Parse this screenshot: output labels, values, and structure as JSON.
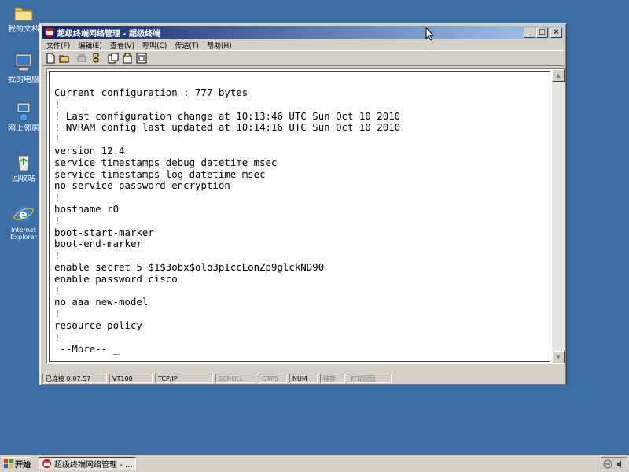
{
  "desktop": {
    "icons": [
      {
        "label": "我的文档"
      },
      {
        "label": "我的电脑"
      },
      {
        "label": "网上邻居"
      },
      {
        "label": "回收站"
      },
      {
        "label": "Internet Explorer"
      }
    ]
  },
  "window": {
    "title": "超级终端网络管理 - 超级终端",
    "menu": [
      {
        "label": "文件(F)"
      },
      {
        "label": "编辑(E)"
      },
      {
        "label": "查看(V)"
      },
      {
        "label": "呼叫(C)"
      },
      {
        "label": "传送(T)"
      },
      {
        "label": "帮助(H)"
      }
    ],
    "toolbar_icons": [
      "new-icon",
      "open-icon",
      "disconnect-icon",
      "connect-icon",
      "send-icon",
      "receive-icon",
      "properties-icon"
    ]
  },
  "terminal": {
    "text": "Current configuration : 777 bytes\n!\n! Last configuration change at 10:13:46 UTC Sun Oct 10 2010\n! NVRAM config last updated at 10:14:16 UTC Sun Oct 10 2010\n!\nversion 12.4\nservice timestamps debug datetime msec\nservice timestamps log datetime msec\nno service password-encryption\n!\nhostname r0\n!\nboot-start-marker\nboot-end-marker\n!\nenable secret 5 $1$3obx$olo3pIccLonZp9glckND90\nenable password cisco\n!\nno aaa new-model\n!\nresource policy\n!\n --More-- _"
  },
  "statusbar": {
    "connection": "已连接 0:07:57",
    "emulation": "VT100",
    "protocol": "TCP/IP",
    "scroll": "SCROLL",
    "caps": "CAPS",
    "num": "NUM",
    "capture": "捕获",
    "print_echo": "打印回显"
  },
  "taskbar": {
    "start_label": "开始",
    "task_label": "超级终端网络管理 - ..."
  }
}
